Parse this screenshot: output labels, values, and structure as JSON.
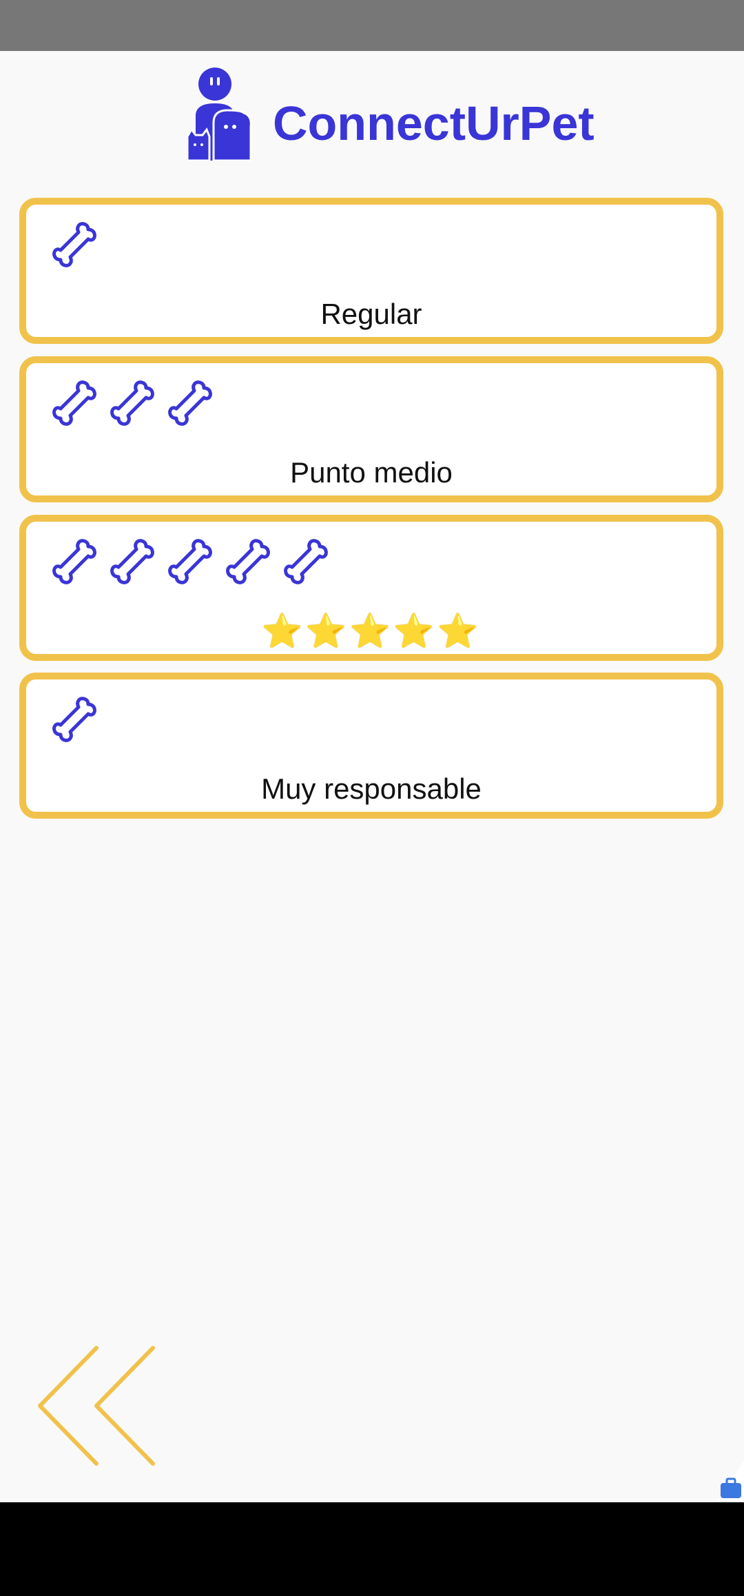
{
  "app": {
    "title": "ConnectUrPet",
    "brand_color": "#3a35d6",
    "accent_color": "#f1c24b"
  },
  "header": {
    "logo_icon": "person-with-pets-icon"
  },
  "ratings": [
    {
      "bones": 1,
      "label": "Regular",
      "label_type": "text"
    },
    {
      "bones": 3,
      "label": "Punto medio",
      "label_type": "text"
    },
    {
      "bones": 5,
      "label": "⭐⭐⭐⭐⭐",
      "label_type": "stars"
    },
    {
      "bones": 1,
      "label": "Muy responsable",
      "label_type": "text"
    }
  ],
  "navigation": {
    "back_icon": "double-chevron-left-icon"
  }
}
